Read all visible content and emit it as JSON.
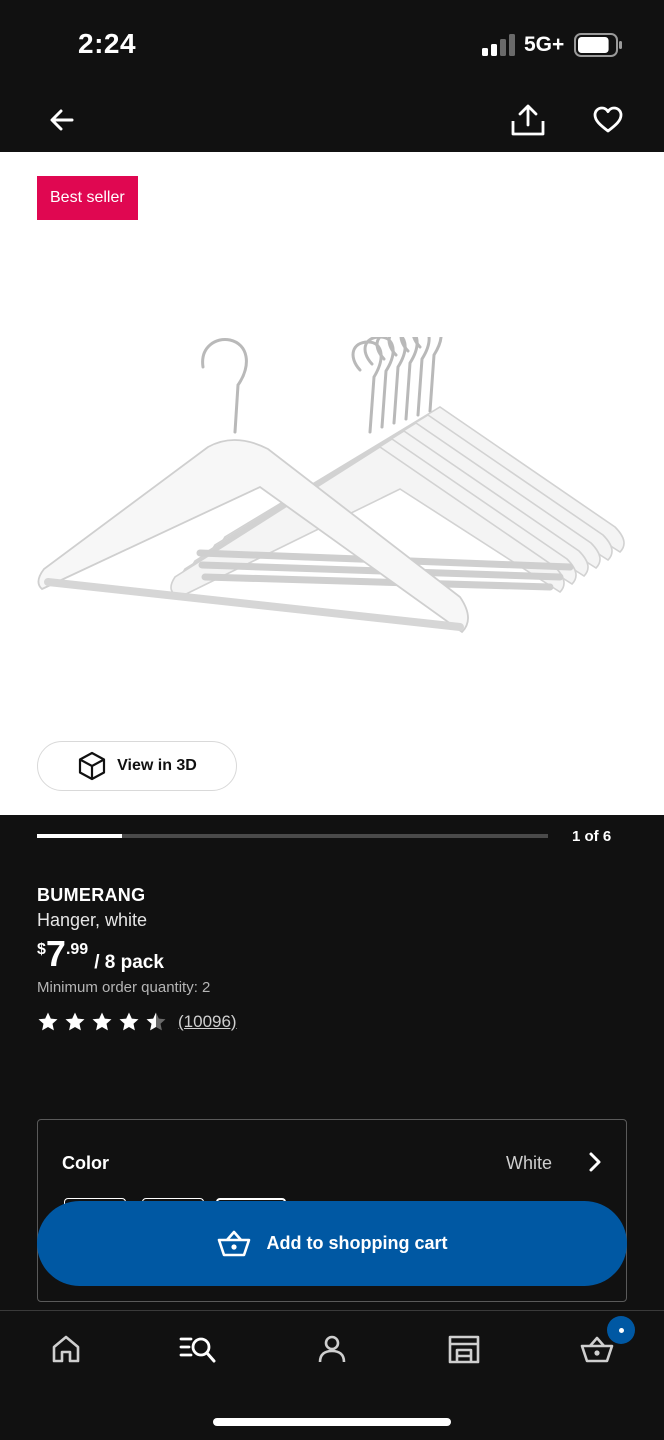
{
  "status_bar": {
    "time": "2:24",
    "network": "5G+",
    "battery_level": 0.85
  },
  "nav": {
    "back_icon": "arrow-left-icon",
    "share_icon": "share-icon",
    "favorite_icon": "heart-icon"
  },
  "gallery": {
    "badge": "Best seller",
    "view_3d_label": "View in 3D",
    "image_counter": "1 of 6",
    "current_image": 1,
    "total_images": 6
  },
  "product": {
    "name": "BUMERANG",
    "description": "Hanger, white",
    "price_currency": "$",
    "price_integer": "7",
    "price_decimal": ".99",
    "price_unit": "/ 8 pack",
    "min_order": "Minimum order quantity: 2",
    "rating": 4.5,
    "review_count": "(10096)"
  },
  "color_selector": {
    "label": "Color",
    "selected": "White"
  },
  "cta": {
    "add_to_cart_label": "Add to shopping cart"
  },
  "tabs": [
    {
      "icon": "home-icon"
    },
    {
      "icon": "search-list-icon"
    },
    {
      "icon": "profile-icon"
    },
    {
      "icon": "store-icon"
    },
    {
      "icon": "cart-icon"
    }
  ],
  "colors": {
    "badge": "#e00751",
    "accent_blue": "#0058a3",
    "background": "#111111"
  }
}
